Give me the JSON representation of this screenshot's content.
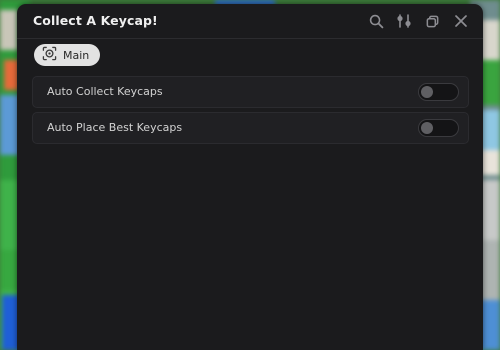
{
  "window": {
    "title": "Collect A Keycap!",
    "actions": [
      {
        "name": "search-icon"
      },
      {
        "name": "settings-sliders-icon"
      },
      {
        "name": "restore-window-icon"
      },
      {
        "name": "close-icon"
      }
    ]
  },
  "tabs": [
    {
      "label": "Main",
      "icon": "target-icon",
      "active": true
    }
  ],
  "options": [
    {
      "label": "Auto Collect Keycaps",
      "enabled": false
    },
    {
      "label": "Auto Place Best Keycaps",
      "enabled": false
    }
  ],
  "colors": {
    "window_bg": "#1b1b1d",
    "row_bg": "#202023",
    "tab_bg": "#e2e2e2",
    "toggle_off": "#5f5f63"
  }
}
